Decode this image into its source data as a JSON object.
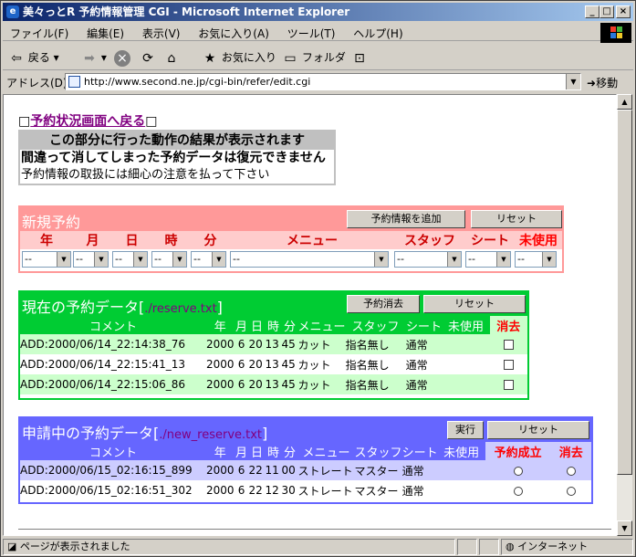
{
  "window": {
    "title": "美々っとR 予約情報管理 CGI - Microsoft Internet Explorer"
  },
  "menu": [
    "ファイル(F)",
    "編集(E)",
    "表示(V)",
    "お気に入り(A)",
    "ツール(T)",
    "ヘルプ(H)"
  ],
  "toolbar": {
    "back": "戻る",
    "favorites": "お気に入り",
    "folder": "フォルダ"
  },
  "address": {
    "label": "アドレス(D)",
    "url": "http://www.second.ne.jp/cgi-bin/refer/edit.cgi",
    "go": "移動"
  },
  "page": {
    "back_link": "予約状況画面へ戻る",
    "info_header": "この部分に行った動作の結果が表示されます",
    "info_line1": "間違って消してしまった予約データは復元できません",
    "info_line2": "予約情報の取扱には細心の注意を払って下さい"
  },
  "new_panel": {
    "title": "新規予約",
    "add_button": "予約情報を追加",
    "reset_button": "リセット",
    "headers": [
      "年",
      "月",
      "日",
      "時",
      "分",
      "メニュー",
      "スタッフ",
      "シート",
      "未使用"
    ],
    "select_value": "--"
  },
  "current_panel": {
    "title": "現在の予約データ",
    "file": "./reserve.txt",
    "delete_button": "予約消去",
    "reset_button": "リセット",
    "headers": [
      "コメント",
      "年",
      "月",
      "日",
      "時",
      "分",
      "メニュー",
      "スタッフ",
      "シート",
      "未使用",
      "消去"
    ],
    "rows": [
      [
        "ADD:2000/06/14_22:14:38_76",
        "2000",
        "6",
        "20",
        "13",
        "45",
        "カット",
        "指名無し",
        "通常",
        ""
      ],
      [
        "ADD:2000/06/14_22:15:41_13",
        "2000",
        "6",
        "20",
        "13",
        "45",
        "カット",
        "指名無し",
        "通常",
        ""
      ],
      [
        "ADD:2000/06/14_22:15:06_86",
        "2000",
        "6",
        "20",
        "13",
        "45",
        "カット",
        "指名無し",
        "通常",
        ""
      ]
    ]
  },
  "pending_panel": {
    "title": "申請中の予約データ",
    "file": "./new_reserve.txt",
    "run_button": "実行",
    "reset_button": "リセット",
    "headers": [
      "コメント",
      "年",
      "月",
      "日",
      "時",
      "分",
      "メニュー",
      "スタッフ",
      "シート",
      "未使用",
      "予約成立",
      "消去"
    ],
    "rows": [
      [
        "ADD:2000/06/15_02:16:15_899",
        "2000",
        "6",
        "22",
        "11",
        "00",
        "ストレート",
        "マスター",
        "通常",
        ""
      ],
      [
        "ADD:2000/06/15_02:16:51_302",
        "2000",
        "6",
        "22",
        "12",
        "30",
        "ストレート",
        "マスター",
        "通常",
        ""
      ]
    ]
  },
  "status": {
    "text": "ページが表示されました",
    "zone": "インターネット"
  }
}
